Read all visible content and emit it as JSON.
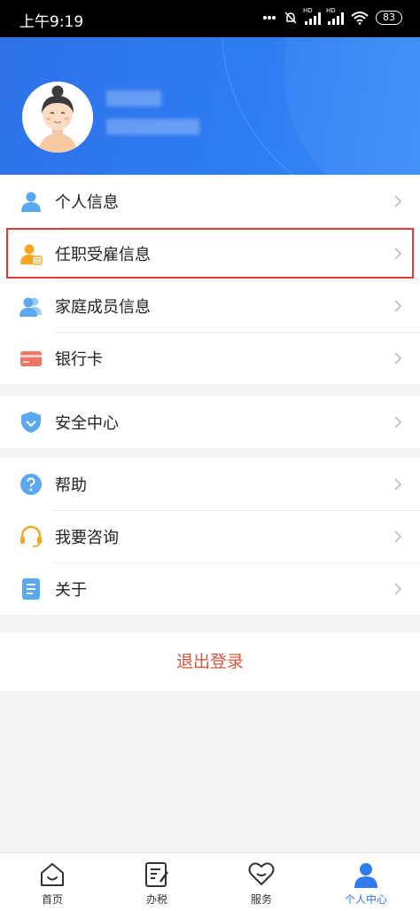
{
  "status_bar": {
    "time": "上午9:19",
    "icons": [
      "dots-icon",
      "mute-icon",
      "hd-signal-icon",
      "hd-signal-icon",
      "wifi-icon"
    ],
    "battery": "83"
  },
  "profile": {
    "avatar": "avatar-icon",
    "name_obscured": true
  },
  "menu_group_1": [
    {
      "label": "个人信息",
      "icon": "person-icon"
    },
    {
      "label": "任职受雇信息",
      "icon": "employment-icon",
      "highlighted": true
    },
    {
      "label": "家庭成员信息",
      "icon": "family-icon"
    },
    {
      "label": "银行卡",
      "icon": "bank-card-icon"
    }
  ],
  "menu_group_2": [
    {
      "label": "安全中心",
      "icon": "shield-icon"
    }
  ],
  "menu_group_3": [
    {
      "label": "帮助",
      "icon": "help-icon"
    },
    {
      "label": "我要咨询",
      "icon": "headset-icon"
    },
    {
      "label": "关于",
      "icon": "document-icon"
    }
  ],
  "logout_label": "退出登录",
  "tabs": [
    {
      "label": "首页",
      "icon": "home-icon"
    },
    {
      "label": "办税",
      "icon": "tax-icon"
    },
    {
      "label": "服务",
      "icon": "service-heart-icon"
    },
    {
      "label": "个人中心",
      "icon": "user-center-icon",
      "active": true
    }
  ],
  "colors": {
    "header_blue": "#2e7cf4",
    "accent_blue": "#2f7bf0",
    "logout_red": "#e0533f",
    "highlight_red": "#e53935",
    "icon_blue": "#5aa9f0",
    "icon_orange": "#f5a623"
  }
}
